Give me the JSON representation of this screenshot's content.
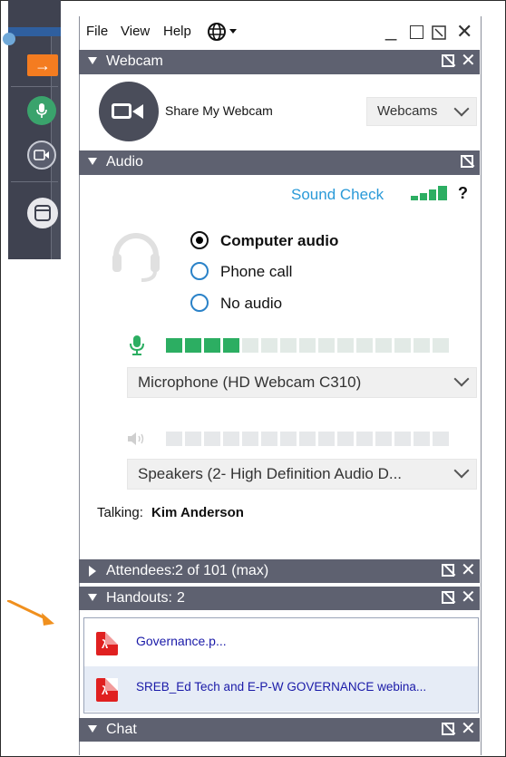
{
  "menu": {
    "file": "File",
    "view": "View",
    "help": "Help"
  },
  "window_controls": {
    "minimize": "_",
    "maximize": "☐",
    "restore": "⧉",
    "close": "✕"
  },
  "webcam": {
    "title": "Webcam",
    "share_label": "Share My Webcam",
    "webcams_dropdown": "Webcams"
  },
  "audio": {
    "title": "Audio",
    "sound_check": "Sound Check",
    "help": "?",
    "options": [
      {
        "label": "Computer audio",
        "selected": true
      },
      {
        "label": "Phone call",
        "selected": false
      },
      {
        "label": "No audio",
        "selected": false
      }
    ],
    "mic_level_segments_on": 4,
    "mic_level_segments_total": 15,
    "speaker_level_segments_on": 0,
    "microphone_dropdown": "Microphone (HD Webcam C310)",
    "speakers_dropdown": "Speakers (2- High Definition Audio D...",
    "talking_label": "Talking:",
    "talking_name": "Kim Anderson"
  },
  "attendees": {
    "title": "Attendees:",
    "count": "2 of 101 (max)"
  },
  "handouts": {
    "title": "Handouts:",
    "count": "2",
    "files": [
      "Governance.p...",
      "SREB_Ed Tech and E-P-W GOVERNANCE webina..."
    ]
  },
  "chat": {
    "title": "Chat"
  },
  "colors": {
    "accent": "#2a9ad8",
    "green": "#2cae62",
    "header_bg": "#5e6170",
    "orange": "#f47c20"
  },
  "icons": {
    "arrow": "arrow-right-icon",
    "mic": "microphone-icon",
    "camera": "webcam-icon",
    "window": "window-icon",
    "globe": "globe-icon",
    "headset": "headset-icon",
    "speaker": "speaker-icon",
    "pdf": "pdf-icon"
  }
}
